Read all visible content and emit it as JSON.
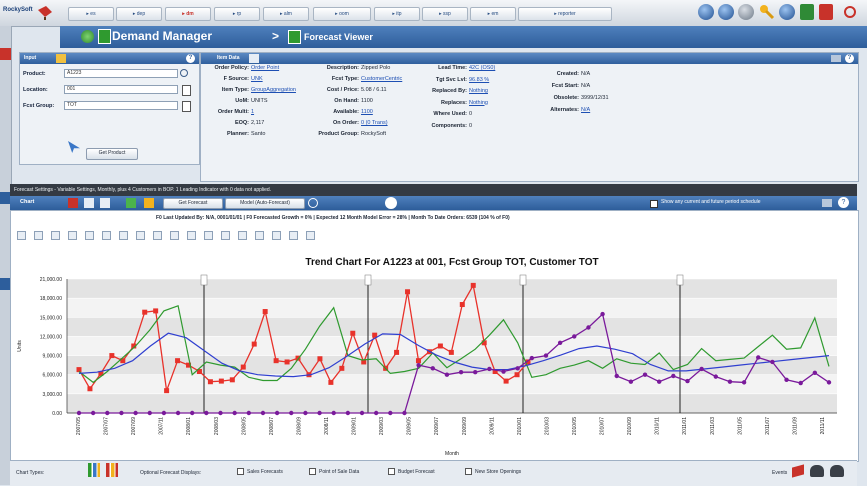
{
  "brand": "RockySoft",
  "topnav": {
    "items": [
      "▸ es",
      "▸ dep",
      "▸ dm",
      "▸ rp",
      "▸ alm",
      "▸ oom",
      "▸ itp",
      "▸ ssp",
      "▸ em",
      "▸ reporter"
    ]
  },
  "breadcrumb": {
    "module": "Demand Manager",
    "separator": ">",
    "page": "Forecast Viewer"
  },
  "input_panel": {
    "title": "Input",
    "product_label": "Product:",
    "product_value": "A1223",
    "location_label": "Location:",
    "location_value": "001",
    "fcst_group_label": "Fcst Group:",
    "fcst_group_value": "TOT",
    "get_button": "Get Product"
  },
  "item_panel": {
    "title": "Item Data",
    "col1": [
      {
        "label": "Order Policy:",
        "value": "Order Point",
        "link": true
      },
      {
        "label": "F Source:",
        "value": "UNK",
        "link": true
      },
      {
        "label": "Item Type:",
        "value": "GroupAggregation",
        "link": true
      },
      {
        "label": "UoM:",
        "value": "UNITS",
        "link": false
      },
      {
        "label": "Order Multi:",
        "value": "1",
        "link": true
      },
      {
        "label": "EOQ:",
        "value": "2,117",
        "link": false
      },
      {
        "label": "Planner:",
        "value": "Santo",
        "link": false
      }
    ],
    "col2": [
      {
        "label": "Description:",
        "value": "Zipped Polo",
        "link": false
      },
      {
        "label": "Fcst Type:",
        "value": "CustomerCentric",
        "link": true
      },
      {
        "label": "Cost / Price:",
        "value": "5.08 / 6.11",
        "link": false
      },
      {
        "label": "On Hand:",
        "value": "1100",
        "link": false
      },
      {
        "label": "Available:",
        "value": "1100",
        "link": true
      },
      {
        "label": "On Order:",
        "value": "0 (0 Trans)",
        "link": true
      },
      {
        "label": "Product Group:",
        "value": "RockySoft",
        "link": false
      }
    ],
    "col3": [
      {
        "label": "Lead Time:",
        "value": "42C (OS0)",
        "link": true
      },
      {
        "label": "Tgt Svc Lvl:",
        "value": "96.83 %",
        "link": true
      },
      {
        "label": "Replaced By:",
        "value": "Nothing",
        "link": true
      },
      {
        "label": "Replaces:",
        "value": "Nothing",
        "link": true
      },
      {
        "label": "Where Used:",
        "value": "0",
        "link": false
      },
      {
        "label": "Components:",
        "value": "0",
        "link": false
      }
    ],
    "col4": [
      {
        "label": "Created:",
        "value": "N/A",
        "link": false
      },
      {
        "label": "Fcst Start:",
        "value": "N/A",
        "link": false
      },
      {
        "label": "Obsolete:",
        "value": "3999/12/31",
        "link": false
      },
      {
        "label": "Alternates:",
        "value": "N/A",
        "link": true
      }
    ]
  },
  "settings_bar": "Forecast Settings - Variable Settings, Monthly, plus 4 Customers in BOP. 1 Leading Indicator with 0 data not applied.",
  "chart_toolbar": {
    "title": "Chart",
    "get_forecast": "Get Forecast",
    "model": "Model (Auto-Forecast)",
    "show_option": "Show any current and future period schedule"
  },
  "stats_line": "F0 Last Updated By: N/A, 0001/01/01  |  F0 Forecasted Growth = 0%  |  Expected 12 Month Model Error = 28%  |  Month To Date Orders: 6539 (104 % of F0)",
  "bottom": {
    "chart_types_label": "Chart Types:",
    "optional_label": "Optional Forecast Displays:",
    "options": [
      "Sales Forecasts",
      "Point of Sale Data",
      "Budget Forecast",
      "New Store Openings"
    ],
    "events_label": "Events"
  },
  "colors": {
    "red_series": "#e8322b",
    "green_series": "#2f9a2f",
    "blue_series": "#2f3fd0",
    "purple_series": "#7a1a9b"
  },
  "chart_data": {
    "type": "line",
    "title": "Trend Chart For A1223 at 001, Fcst Group TOT, Customer TOT",
    "xlabel": "Month",
    "ylabel": "Units",
    "ylim": [
      0,
      21000
    ],
    "yticks": [
      "0.00",
      "3,000.00",
      "6,000.00",
      "9,000.00",
      "12,000.00",
      "15,000.00",
      "18,000.00",
      "21,000.00"
    ],
    "categories": [
      "2007/05",
      "2007/07",
      "2007/09",
      "2007/11",
      "2008/01",
      "2008/03",
      "2008/05",
      "2008/07",
      "2008/09",
      "2008/11",
      "2009/01",
      "2009/03",
      "2009/05",
      "2009/07",
      "2009/09",
      "2009/11",
      "2010/01",
      "2010/03",
      "2010/05",
      "2010/07",
      "2010/09",
      "2010/11",
      "2011/01",
      "2011/03",
      "2011/05",
      "2011/07",
      "2011/09",
      "2011/11"
    ],
    "series": [
      {
        "values": [
          6800,
          3800,
          6200,
          9000,
          8200,
          10500,
          15800,
          16000,
          3500,
          8200,
          7500,
          6500,
          4900,
          5000,
          5200,
          7200,
          10800,
          15900,
          8200,
          8000,
          8600,
          6000,
          8500,
          4800,
          7000,
          12500,
          8000,
          12200,
          7000,
          9500,
          19000,
          8200,
          9600,
          10500,
          9500,
          17000,
          20000,
          11000,
          6500,
          5000,
          6000,
          8000
        ]
      },
      {
        "values": [
          6500,
          4800,
          6500,
          8500,
          10500,
          13000,
          16000,
          16800,
          6000,
          8000,
          7500,
          7200,
          5600,
          5100,
          5100,
          7000,
          10000,
          13600,
          16500,
          9000,
          8300,
          8500,
          6200,
          6500,
          7000,
          9400,
          7100,
          8500,
          10000,
          12200,
          14600,
          11000,
          5600,
          6000,
          7000,
          7500,
          8200,
          7000,
          8500,
          7800,
          7600,
          9400,
          6800,
          7600,
          10100,
          8200,
          8400,
          8600,
          10400,
          12200,
          10000,
          10200,
          14900,
          7300
        ]
      },
      {
        "values": [
          6200,
          6400,
          7000,
          8200,
          10500,
          12500,
          11800,
          9800,
          7800,
          6600,
          6000,
          5800,
          5700,
          6000,
          7100,
          8900,
          10800,
          12400,
          12300,
          10600,
          9100,
          8000,
          7200,
          6800,
          6800,
          7400,
          8200,
          9100,
          10100,
          10500,
          10000,
          9300,
          7600,
          6600,
          6600,
          6900,
          7200,
          7500,
          7800,
          8100,
          8400,
          8700,
          9000
        ]
      },
      {
        "values": [
          0,
          0,
          0,
          0,
          0,
          0,
          0,
          0,
          0,
          0,
          0,
          0,
          0,
          0,
          0,
          0,
          0,
          0,
          0,
          0,
          0,
          0,
          0,
          0,
          7500,
          7000,
          6000,
          6400,
          6400,
          6900,
          6500,
          7000,
          8600,
          9000,
          11000,
          12000,
          13400,
          15500,
          5800,
          4900,
          6000,
          4900,
          5800,
          5000,
          6900,
          5700,
          4900,
          4800,
          8700,
          8000,
          5200,
          4700,
          6300,
          4800
        ]
      }
    ]
  }
}
